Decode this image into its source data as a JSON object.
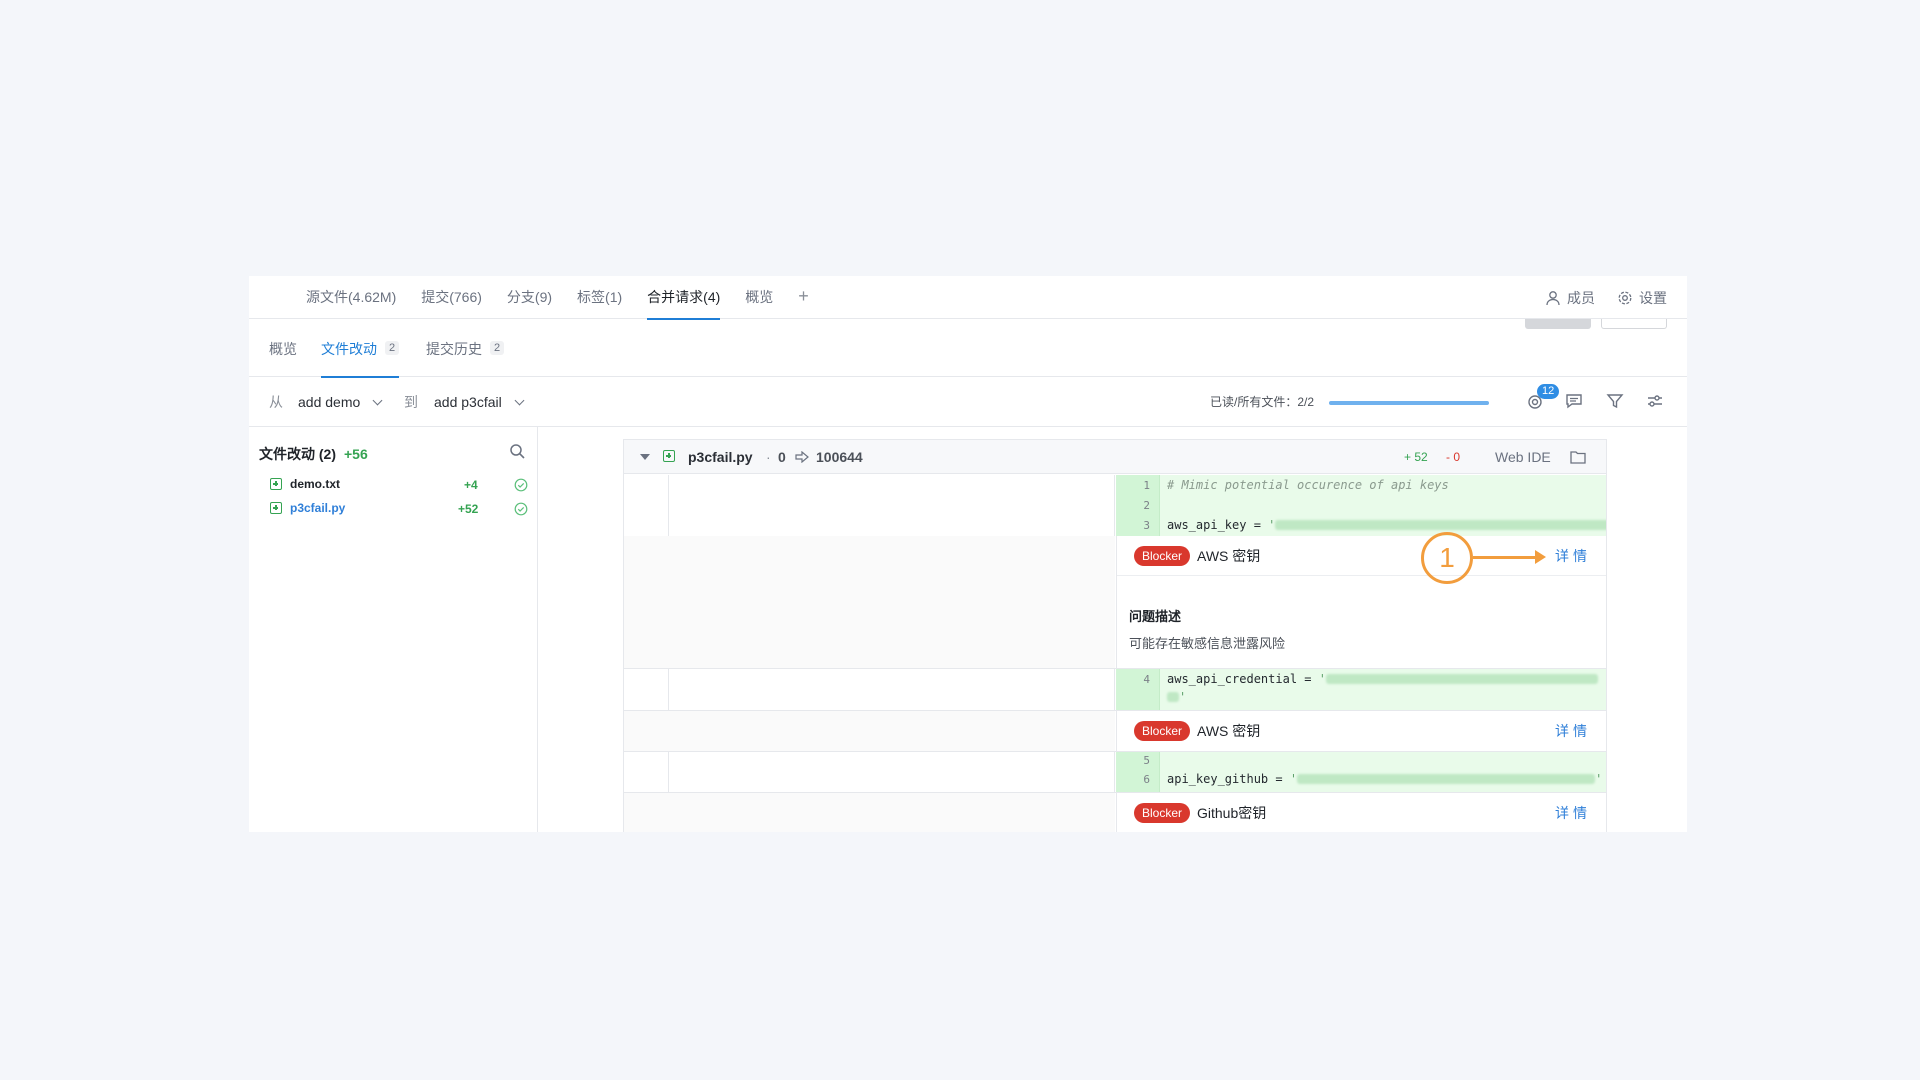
{
  "topnav": {
    "tabs": [
      "源文件(4.62M)",
      "提交(766)",
      "分支(9)",
      "标签(1)",
      "合并请求(4)",
      "概览"
    ],
    "active_index": 4,
    "add_label": "+",
    "members_label": "成员",
    "settings_label": "设置"
  },
  "subtabs": {
    "overview": "概览",
    "changes": "文件改动",
    "changes_count": "2",
    "history": "提交历史",
    "history_count": "2"
  },
  "branchbar": {
    "from_label": "从",
    "from_branch": "add demo",
    "to_label": "到",
    "to_branch": "add p3cfail",
    "read_label": "已读/所有文件：2/2",
    "read_progress": 1.0,
    "notification_count": "12"
  },
  "filetree": {
    "title": "文件改动 (2)",
    "added": "+56",
    "files": [
      {
        "name": "demo.txt",
        "added": "+4",
        "color": "#1f2329"
      },
      {
        "name": "p3cfail.py",
        "added": "+52",
        "color": "#2f7fd8"
      }
    ]
  },
  "diff": {
    "filename": "p3cfail.py",
    "mode_old": "0",
    "mode_new": "100644",
    "added": "+ 52",
    "removed": "- 0",
    "web_ide": "Web IDE",
    "lines": {
      "l1": "1",
      "l2": "2",
      "l3": "3",
      "l4": "4",
      "l5": "5",
      "l6": "6",
      "c1": "# Mimic potential occurence of api keys",
      "c3_key": "aws_api_key = ",
      "c4_key": "aws_api_credential = ",
      "c6_key": "api_key_github = "
    },
    "issues": [
      {
        "severity": "Blocker",
        "title": "AWS 密钥",
        "detail": "详情",
        "desc_heading": "问题描述",
        "desc_text": "可能存在敏感信息泄露风险"
      },
      {
        "severity": "Blocker",
        "title": "AWS 密钥",
        "detail": "详情"
      },
      {
        "severity": "Blocker",
        "title": "Github密钥",
        "detail": "详情"
      }
    ]
  },
  "annotation": {
    "number": "1"
  },
  "colors": {
    "accent": "#1f7ed6",
    "added": "#35a352",
    "blocker": "#d9382d",
    "annotation": "#f29d3d"
  }
}
